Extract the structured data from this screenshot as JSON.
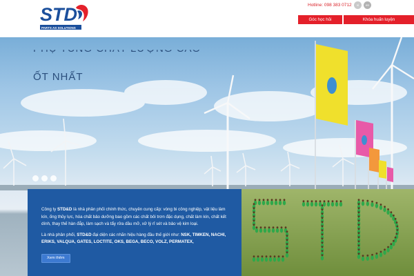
{
  "header": {
    "logo_text": "STD",
    "logo_tagline": "PARTS AS SOLUTIONS",
    "hotline": "Hotline: 098 383 0712",
    "lang_vi": "vi",
    "lang_en": "en",
    "nav": [
      "Góc học hỏi",
      "Khóa huấn luyện"
    ]
  },
  "hero": {
    "line1": "PHỤ TÙNG CHẤT LƯỢNG CAO",
    "line2": "ỐT NHẤT",
    "active_slide": 3,
    "slide_count": 3
  },
  "intro": {
    "p1_prefix": "Công ty ",
    "p1_brand": "STD&D",
    "p1_text": " là nhà phân phối chính thức, chuyên cung cấp: vòng bi công nghiệp, vật liệu làm kín, ống thủy lực, hóa chất bảo dưỡng bao gồm các chất bôi trơn đặc dụng, chất làm kín, chất kết dính, thay thế hàn đắp, làm sạch và tẩy rửa dầu mỡ, xử lý rỉ sét và bảo vệ kim loại.",
    "p2_prefix": "Là nhà phân phối, ",
    "p2_brand": "STD&D",
    "p2_text": " đại diện các nhãn hiệu hàng đầu thế giới như: ",
    "p2_brands": "NSK, TIMKEN, NACHI, ERIKS, VALQUA, GATES, LOCTITE, OKS, BEGA, BECO, VOLZ, PERMATEX,",
    "more_button": "Xem thêm"
  },
  "colors": {
    "brand_red": "#e4202a",
    "brand_blue": "#1f5aa3",
    "button_blue": "#3d7ad1"
  }
}
